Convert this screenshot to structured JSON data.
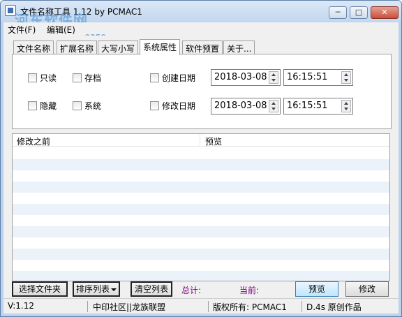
{
  "window": {
    "title": "文件名称工具 1.12   by  PCMAC1",
    "watermark": "河东软件网",
    "watermark_url": "www.pc0359.cn",
    "minimize_glyph": "─",
    "maximize_glyph": "□",
    "close_glyph": "✕"
  },
  "menu": {
    "items": [
      {
        "label": "文件(F)"
      },
      {
        "label": "编辑(E)"
      }
    ]
  },
  "tabs": [
    {
      "label": "文件名称",
      "active": false
    },
    {
      "label": "扩展名称",
      "active": false
    },
    {
      "label": "大写小写",
      "active": false
    },
    {
      "label": "系统属性",
      "active": true
    },
    {
      "label": "软件预置",
      "active": false
    },
    {
      "label": "关于...",
      "active": false
    }
  ],
  "attributes": {
    "readonly": {
      "label": "只读",
      "checked": false
    },
    "archive": {
      "label": "存档",
      "checked": false
    },
    "hidden": {
      "label": "隐藏",
      "checked": false
    },
    "system": {
      "label": "系统",
      "checked": false
    },
    "created": {
      "label": "创建日期",
      "checked": false,
      "date": "2018-03-08",
      "time": "16:15:51"
    },
    "modified": {
      "label": "修改日期",
      "checked": false,
      "date": "2018-03-08",
      "time": "16:15:51"
    }
  },
  "list": {
    "columns": [
      "修改之前",
      "预览"
    ],
    "rows": []
  },
  "buttons": {
    "select_folder": "选择文件夹",
    "sort_list": "排序列表",
    "clear_list": "清空列表",
    "preview": "预览",
    "modify": "修改"
  },
  "stats": {
    "total_label": "总计:",
    "current_label": "当前:"
  },
  "statusbar": {
    "version": "V:1.12",
    "community": "中印社区||龙族联盟",
    "copyright": "版权所有: PCMAC1",
    "credit": "D.4s 原创作品"
  },
  "colors": {
    "titlebar": "#c3d7ef",
    "stat_label": "#800080",
    "list_alt_row": "#ebf2fa",
    "preview_button": "#bee6fd"
  }
}
